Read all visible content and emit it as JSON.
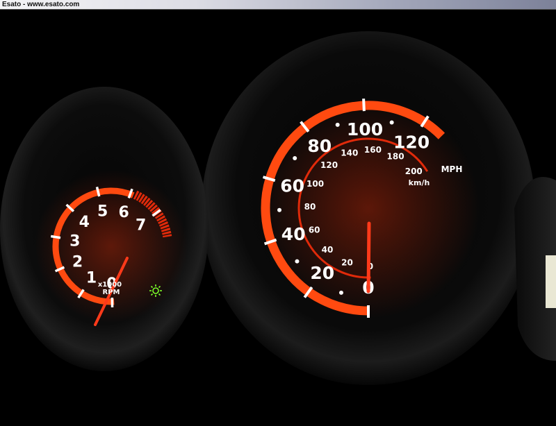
{
  "window": {
    "title": "Esato - www.esato.com"
  },
  "colors": {
    "arc_orange": "#ff4a10",
    "arc_red": "#e02a0a",
    "needle": "#ff3a1a",
    "indicator_green": "#7cff2a",
    "background": "#000000"
  },
  "tachometer": {
    "labels": [
      "0",
      "1",
      "2",
      "3",
      "4",
      "5",
      "6",
      "7"
    ],
    "unit_line1": "x1000",
    "unit_line2": "RPM",
    "indicator_icon": "sun-icon"
  },
  "speedometer": {
    "mph_labels": [
      "0",
      "20",
      "40",
      "60",
      "80",
      "100",
      "120"
    ],
    "mph_unit": "MPH",
    "kmh_labels": [
      "0",
      "20",
      "40",
      "60",
      "80",
      "100",
      "120",
      "140",
      "160",
      "180",
      "200"
    ],
    "kmh_unit": "km/h"
  }
}
